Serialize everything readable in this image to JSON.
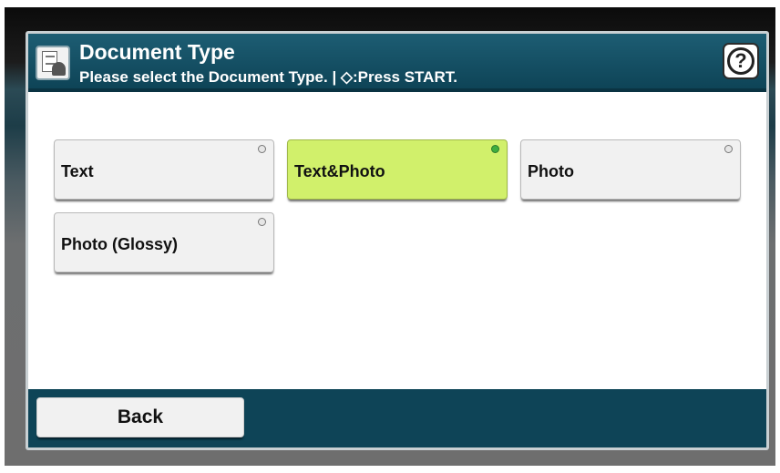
{
  "header": {
    "title": "Document Type",
    "subtitle": "Please select the Document Type. | ◇:Press START.",
    "help_label": "?",
    "icon": "document-type-icon"
  },
  "options": [
    {
      "label": "Text",
      "selected": false
    },
    {
      "label": "Text&Photo",
      "selected": true
    },
    {
      "label": "Photo",
      "selected": false
    },
    {
      "label": "Photo (Glossy)",
      "selected": false
    }
  ],
  "footer": {
    "back_label": "Back"
  },
  "colors": {
    "header": "#0e4457",
    "selected": "#d1f06b",
    "option": "#f1f1f1"
  }
}
